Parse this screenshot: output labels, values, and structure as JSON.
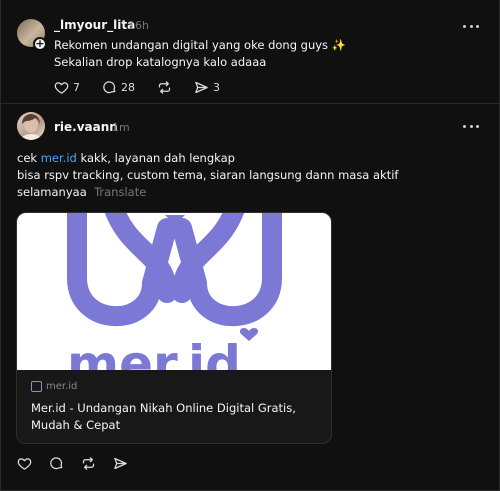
{
  "post1": {
    "username": "_lmyour_lita",
    "time": "16h",
    "line1": "Rekomen undangan digital yang oke dong guys ✨",
    "line2": "Sekalian drop katalognya kalo adaaa",
    "likes": "7",
    "replies": "28",
    "shares": "3"
  },
  "post2": {
    "username": "rie.vaann",
    "time": "1m",
    "text_prefix": "cek ",
    "mention": "mer.id",
    "text_suffix": " kakk, layanan dah lengkap",
    "line2": "bisa rspv tracking, custom tema, siaran langsung dann masa aktif",
    "line3": "selamanyaa",
    "translate": "Translate",
    "card": {
      "domain": "mer.id",
      "title": "Mer.id - Undangan Nikah Online Digital Gratis, Mudah & Cepat",
      "logo_text": "mer.id",
      "brand_color": "#7b78d6"
    }
  },
  "icons": {
    "like": "heart-icon",
    "reply": "comment-icon",
    "repost": "repost-icon",
    "share": "send-icon",
    "more": "more-icon"
  }
}
